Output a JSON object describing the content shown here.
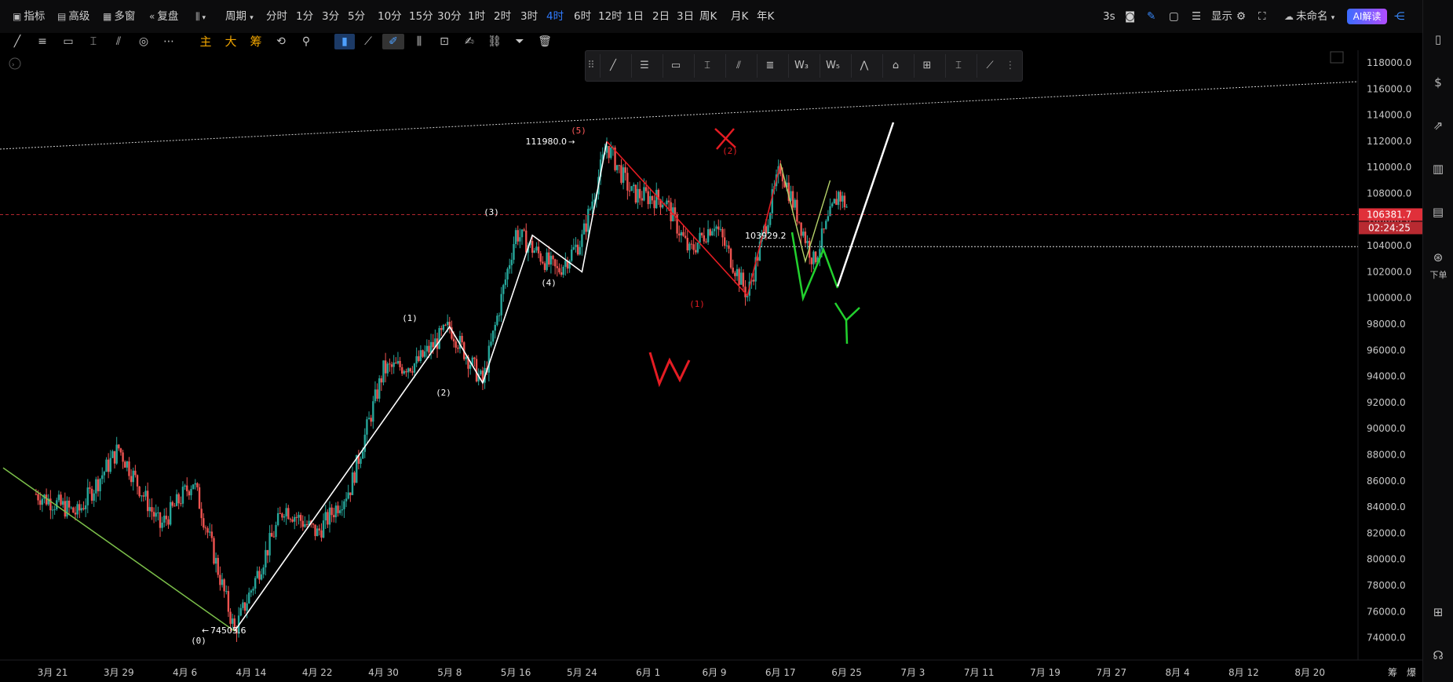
{
  "toolbar": {
    "indicators": "指标",
    "advanced": "高级",
    "multi_window": "多窗",
    "replay": "复盘",
    "period_menu": "周期",
    "periods": [
      "分时",
      "1分",
      "3分",
      "5分",
      "10分",
      "15分",
      "30分",
      "1时",
      "2时",
      "3时",
      "4时",
      "6时",
      "12时",
      "1日",
      "2日",
      "3日",
      "周K",
      "月K",
      "年K"
    ],
    "active_period": "4时",
    "refresh": "3s",
    "display": "显示",
    "layout_name": "未命名",
    "ai_button": "AI解读"
  },
  "drawing_toolbar": {
    "tools": [
      "trend-line",
      "horizontal-lines",
      "rectangle",
      "price-range",
      "parallel-channel",
      "fib-circle",
      "more"
    ],
    "cn_tools": [
      "主",
      "大",
      "筹"
    ]
  },
  "floating_toolbar": {
    "tools": [
      "line",
      "horizontal",
      "rectangle",
      "range",
      "channel",
      "fib",
      "wave-3",
      "wave-5",
      "triangle",
      "pattern",
      "measure",
      "text",
      "brush"
    ]
  },
  "sidebar": {
    "order_label": "下单"
  },
  "chart_data": {
    "type": "candlestick",
    "y_axis": {
      "ticks": [
        118000,
        116000,
        114000,
        112000,
        110000,
        108000,
        106000,
        104000,
        102000,
        100000,
        98000,
        96000,
        94000,
        92000,
        90000,
        88000,
        86000,
        84000,
        82000,
        80000,
        78000,
        76000,
        74000
      ],
      "tick_labels": [
        "118000.0",
        "116000.0",
        "114000.0",
        "112000.0",
        "110000.0",
        "108000.0",
        "106000.0",
        "104000.0",
        "102000.0",
        "100000.0",
        "98000.0",
        "96000.0",
        "94000.0",
        "92000.0",
        "90000.0",
        "88000.0",
        "86000.0",
        "84000.0",
        "82000.0",
        "80000.0",
        "78000.0",
        "76000.0",
        "74000.0"
      ],
      "range": [
        73000,
        118800
      ]
    },
    "x_axis": {
      "tick_labels": [
        "3月 21",
        "3月 29",
        "4月 6",
        "4月 14",
        "4月 22",
        "4月 30",
        "5月 8",
        "5月 16",
        "5月 24",
        "6月 1",
        "6月 9",
        "6月 17",
        "6月 25",
        "7月 3",
        "7月 11",
        "7月 19",
        "7月 27",
        "8月 4",
        "8月 12",
        "8月 20"
      ],
      "corner_labels": [
        "筹",
        "爆"
      ]
    },
    "current_price": {
      "label": "106381.7",
      "value": 106381.7,
      "countdown": "02:24:25",
      "color": "#e0303a"
    },
    "price_labels": {
      "high": {
        "text": "111980.0",
        "value": 111980.0
      },
      "low": {
        "text": "74505.6",
        "value": 74505.6
      },
      "mid": {
        "text": "103929.2",
        "value": 103929.2
      }
    },
    "wave_labels": [
      "(0)",
      "(1)",
      "(2)",
      "(3)",
      "(4)",
      "(5)",
      "(1)",
      "(2)"
    ],
    "handwritten_labels": [
      "W",
      "X",
      "Y"
    ],
    "colors": {
      "up": "#26a69a",
      "down": "#ef5350",
      "impulse": "#ffffff",
      "correction": "#e51c23",
      "forecast": "#22d12e",
      "trendline": "#7cc04a"
    }
  }
}
